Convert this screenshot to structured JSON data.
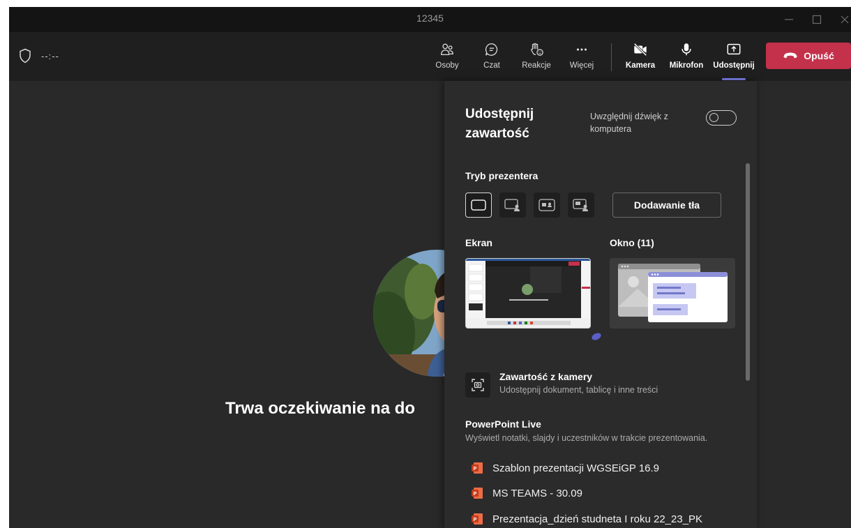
{
  "window": {
    "title": "12345"
  },
  "toolbar": {
    "timer": "--:--",
    "items": [
      {
        "label": "Osoby",
        "icon": "people-icon"
      },
      {
        "label": "Czat",
        "icon": "chat-icon"
      },
      {
        "label": "Reakcje",
        "icon": "raise-hand-icon"
      },
      {
        "label": "Więcej",
        "icon": "more-icon"
      },
      {
        "label": "Kamera",
        "icon": "camera-off-icon"
      },
      {
        "label": "Mikrofon",
        "icon": "microphone-icon"
      },
      {
        "label": "Udostępnij",
        "icon": "share-icon"
      }
    ],
    "leave_label": "Opuść",
    "accent": "#7f85f5",
    "leave_color": "#c4314b"
  },
  "stage": {
    "waiting_text": "Trwa oczekiwanie na do"
  },
  "share_panel": {
    "title": "Udostępnij zawartość",
    "include_audio": "Uwzględnij dźwięk z komputera",
    "include_audio_on": false,
    "presenter_mode_label": "Tryb prezentera",
    "background_button": "Dodawanie tła",
    "screen_label": "Ekran",
    "window_label": "Okno (11)",
    "camera_content": {
      "title": "Zawartość z kamery",
      "description": "Udostępnij dokument, tablicę i inne treści"
    },
    "powerpoint": {
      "title": "PowerPoint Live",
      "description": "Wyświetl notatki, slajdy i uczestników w trakcie prezentowania.",
      "files": [
        "Szablon prezentacji WGSEiGP 16.9",
        "MS TEAMS - 30.09",
        "Prezentacja_dzień studneta I roku 22_23_PK"
      ]
    }
  }
}
